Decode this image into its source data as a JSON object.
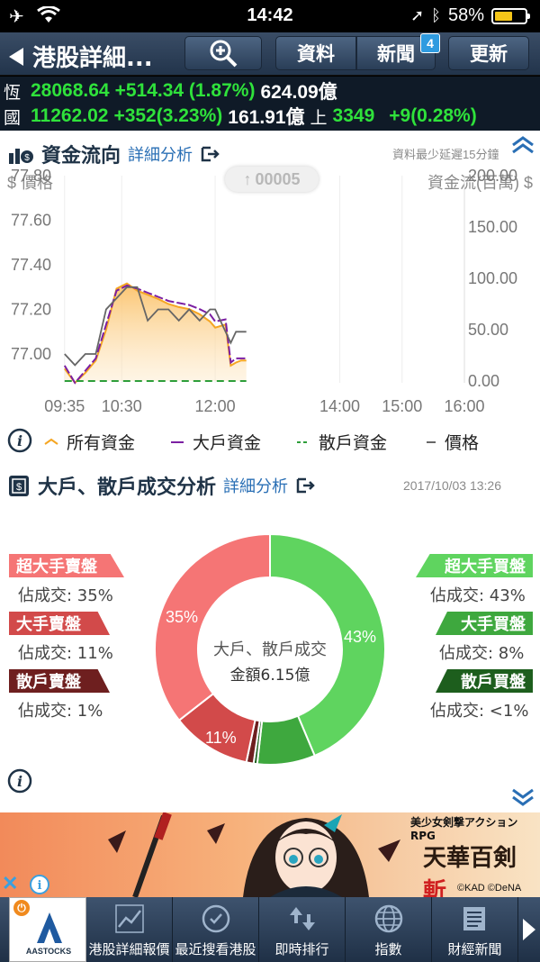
{
  "status_bar": {
    "time": "14:42",
    "battery": "58%",
    "battery_level": 0.58
  },
  "nav": {
    "title": "港股詳細...",
    "data_button": "資料",
    "news_button": "新聞",
    "news_badge": "4",
    "refresh_button": "更新"
  },
  "indices": {
    "hsi_label": "恆",
    "hsi_value": "28068.64",
    "hsi_change": "+514.34 (1.87%)",
    "hsi_turnover": "624.09億",
    "hscei_label": "國",
    "hscei_value": "11262.02",
    "hscei_change": "+352(3.23%)",
    "hscei_turnover": "161.91億",
    "sh_label": "上",
    "sh_value": "3349",
    "sh_change": "+9(0.28%)"
  },
  "fund_flow": {
    "title": "資金流向",
    "detail_link": "詳細分析",
    "delay_note": "資料最少延遲15分鐘",
    "price_axis_label": "$ 價格",
    "flow_axis_label": "資金流(百萬) $",
    "stock_code": "00005"
  },
  "chart_data": {
    "type": "line",
    "x_ticks": [
      "09:35",
      "10:30",
      "12:00",
      "14:00",
      "15:00",
      "16:00"
    ],
    "y_left_ticks": [
      "77.80",
      "77.60",
      "77.40",
      "77.20",
      "77.00"
    ],
    "y_right_ticks": [
      "200.00",
      "150.00",
      "100.00",
      "50.00",
      "0.00"
    ],
    "ylim_left": [
      76.9,
      77.8
    ],
    "ylim_right": [
      0,
      200
    ],
    "legend_position": "bottom",
    "series": [
      {
        "name": "所有資金",
        "color": "#f5a623",
        "axis": "right",
        "area": true,
        "x": [
          "09:35",
          "09:45",
          "09:55",
          "10:05",
          "10:15",
          "10:25",
          "10:35",
          "10:45",
          "10:55",
          "11:05",
          "11:15",
          "11:25",
          "11:35",
          "11:45",
          "11:55",
          "12:00",
          "12:10",
          "12:15",
          "12:20",
          "12:25",
          "12:30"
        ],
        "values": [
          12,
          -5,
          8,
          20,
          50,
          90,
          95,
          88,
          84,
          80,
          75,
          72,
          70,
          65,
          58,
          52,
          55,
          15,
          18,
          20,
          20
        ]
      },
      {
        "name": "大戶資金",
        "color": "#7b1fa2",
        "axis": "right",
        "x": [
          "09:35",
          "09:45",
          "09:55",
          "10:05",
          "10:15",
          "10:25",
          "10:35",
          "10:45",
          "10:55",
          "11:05",
          "11:15",
          "11:25",
          "11:35",
          "11:45",
          "11:55",
          "12:00",
          "12:10",
          "12:15",
          "12:20",
          "12:25",
          "12:30"
        ],
        "values": [
          15,
          -3,
          10,
          22,
          55,
          88,
          93,
          90,
          86,
          82,
          78,
          76,
          74,
          70,
          65,
          58,
          60,
          18,
          22,
          22,
          22
        ]
      },
      {
        "name": "散戶資金",
        "color": "#2e9e3a",
        "axis": "right",
        "dashed": true,
        "x": [
          "09:35",
          "10:30",
          "12:00",
          "12:30"
        ],
        "values": [
          0,
          0,
          0,
          0
        ]
      },
      {
        "name": "價格",
        "color": "#666666",
        "axis": "left",
        "x": [
          "09:35",
          "09:45",
          "09:55",
          "10:05",
          "10:15",
          "10:25",
          "10:35",
          "10:45",
          "10:55",
          "11:05",
          "11:15",
          "11:25",
          "11:35",
          "11:45",
          "11:55",
          "12:00",
          "12:05",
          "12:10",
          "12:15",
          "12:20",
          "12:25",
          "12:30"
        ],
        "values": [
          77.0,
          76.95,
          77.0,
          77.0,
          77.2,
          77.25,
          77.3,
          77.3,
          77.15,
          77.2,
          77.2,
          77.15,
          77.2,
          77.15,
          77.2,
          77.2,
          77.15,
          77.1,
          77.05,
          77.1,
          77.1,
          77.1
        ]
      }
    ]
  },
  "legend": {
    "all": "所有資金",
    "large": "大戶資金",
    "retail": "散戶資金",
    "price": "價格"
  },
  "trade_analysis": {
    "title": "大戶、散戶成交分析",
    "detail_link": "詳細分析",
    "timestamp": "2017/10/03 13:26",
    "center_line1": "大戶、散戶成交",
    "center_line2": "金額6.15億",
    "share_prefix": "佔成交: ",
    "sell_super_label": "超大手賣盤",
    "sell_super_pct": "35%",
    "sell_large_label": "大手賣盤",
    "sell_large_pct": "11%",
    "sell_retail_label": "散戶賣盤",
    "sell_retail_pct": "1%",
    "buy_super_label": "超大手買盤",
    "buy_super_pct": "43%",
    "buy_large_label": "大手買盤",
    "buy_large_pct": "8%",
    "buy_retail_label": "散戶買盤",
    "buy_retail_pct": "<1%",
    "donut_label_35": "35%",
    "donut_label_43": "43%",
    "donut_label_11": "11%"
  },
  "donut_data": {
    "type": "pie",
    "slices": [
      {
        "name": "超大手買盤",
        "value": 43,
        "color": "#5fd45f"
      },
      {
        "name": "大手買盤",
        "value": 8,
        "color": "#3ea83e"
      },
      {
        "name": "散戶買盤",
        "value": 0.5,
        "color": "#1d5e1d"
      },
      {
        "name": "散戶賣盤",
        "value": 1,
        "color": "#6e1f1f"
      },
      {
        "name": "大手賣盤",
        "value": 11,
        "color": "#d24a4a"
      },
      {
        "name": "超大手賣盤",
        "value": 35,
        "color": "#f57575"
      }
    ]
  },
  "ad": {
    "tagline": "美少女剣撃アクションRPG",
    "game_title": "天華百剣",
    "game_title_accent": "斬",
    "copyright": "©KAD ©DeNA"
  },
  "tabbar": {
    "logo": "AASTOCKS",
    "tab1": "港股詳細報價",
    "tab2": "最近搜看港股",
    "tab3": "即時排行",
    "tab4": "指數",
    "tab5": "財經新聞"
  }
}
